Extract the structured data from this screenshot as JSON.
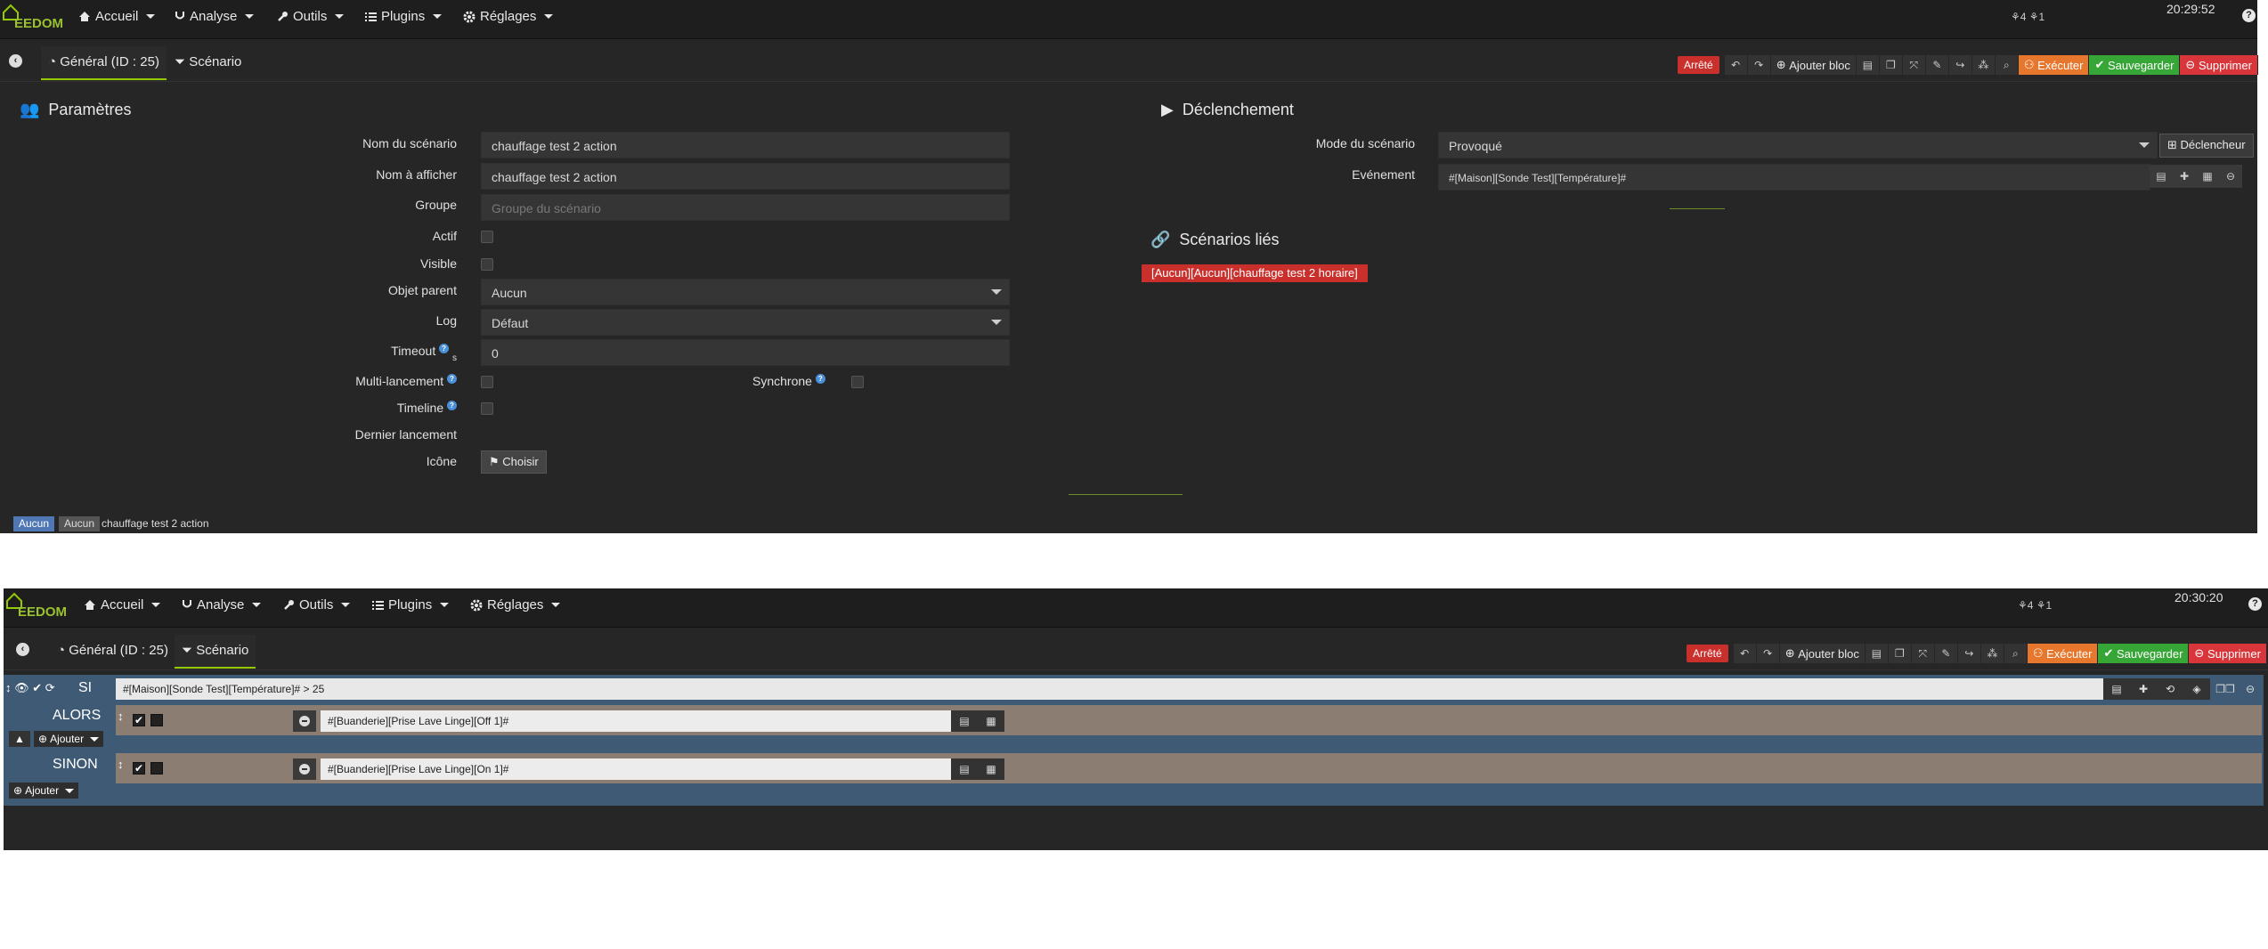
{
  "nav": {
    "logo": "EEDOM",
    "items": [
      "Accueil",
      "Analyse",
      "Outils",
      "Plugins",
      "Réglages"
    ],
    "status_icons": "⚘4 ⚘1"
  },
  "screen1": {
    "clock": "20:29:52",
    "tabs": {
      "general": "Général (ID : 25)",
      "scenario": "Scénario"
    },
    "toolbar": {
      "state": "Arrêté",
      "add_block": "Ajouter bloc",
      "execute": "Exécuter",
      "save": "Sauvegarder",
      "delete": "Supprimer"
    },
    "params": {
      "title": "Paramètres",
      "name_label": "Nom du scénario",
      "name_value": "chauffage test 2 action",
      "display_label": "Nom à afficher",
      "display_value": "chauffage test 2 action",
      "group_label": "Groupe",
      "group_placeholder": "Groupe du scénario",
      "active_label": "Actif",
      "visible_label": "Visible",
      "parent_label": "Objet parent",
      "parent_value": "Aucun",
      "log_label": "Log",
      "log_value": "Défaut",
      "timeout_label": "Timeout",
      "timeout_unit": "s",
      "timeout_value": "0",
      "multi_label": "Multi-lancement",
      "sync_label": "Synchrone",
      "timeline_label": "Timeline",
      "last_label": "Dernier lancement",
      "icon_label": "Icône",
      "icon_button": "Choisir"
    },
    "trigger": {
      "title": "Déclenchement",
      "mode_label": "Mode du scénario",
      "mode_value": "Provoqué",
      "trigger_button": "Déclencheur",
      "event_label": "Evénement",
      "event_value": "#[Maison][Sonde Test][Température]#"
    },
    "linked": {
      "title": "Scénarios liés",
      "item": "[Aucun][Aucun][chauffage test 2 horaire]"
    },
    "footer": {
      "badge1": "Aucun",
      "badge2": "Aucun",
      "name": "chauffage test 2 action"
    }
  },
  "screen2": {
    "clock": "20:30:20",
    "tabs": {
      "general": "Général (ID : 25)",
      "scenario": "Scénario"
    },
    "toolbar": {
      "state": "Arrêté",
      "add_block": "Ajouter bloc",
      "execute": "Exécuter",
      "save": "Sauvegarder",
      "delete": "Supprimer"
    },
    "block": {
      "si": "SI",
      "condition": "#[Maison][Sonde Test][Température]# > 25",
      "alors": "ALORS",
      "action_then": "#[Buanderie][Prise Lave Linge][Off 1]#",
      "sinon": "SINON",
      "action_else": "#[Buanderie][Prise Lave Linge][On 1]#",
      "add_label": "Ajouter"
    }
  }
}
